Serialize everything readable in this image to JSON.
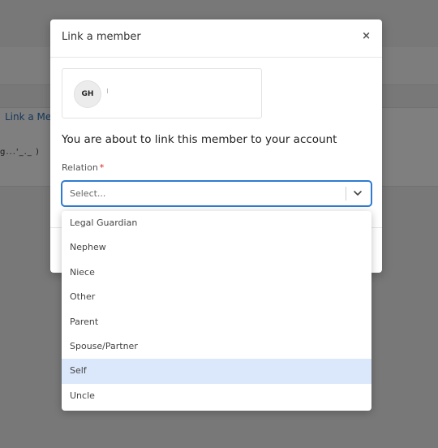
{
  "background": {
    "link_text": "Link a Me",
    "scribble_text": "g...'_._ )"
  },
  "modal": {
    "title": "Link a member",
    "close_label": "×",
    "member": {
      "initials": "GH"
    },
    "heading": "You are about to link this member to your account",
    "relation_label": "Relation",
    "required_mark": "*",
    "select": {
      "placeholder": "Select..."
    }
  },
  "dropdown": {
    "options": [
      "Legal Guardian",
      "Nephew",
      "Niece",
      "Other",
      "Parent",
      "Spouse/Partner",
      "Self",
      "Uncle"
    ],
    "highlighted": "Self"
  },
  "colors": {
    "accent": "#2f7bd1",
    "highlight": "#dbe7fb",
    "required": "#d22222"
  }
}
